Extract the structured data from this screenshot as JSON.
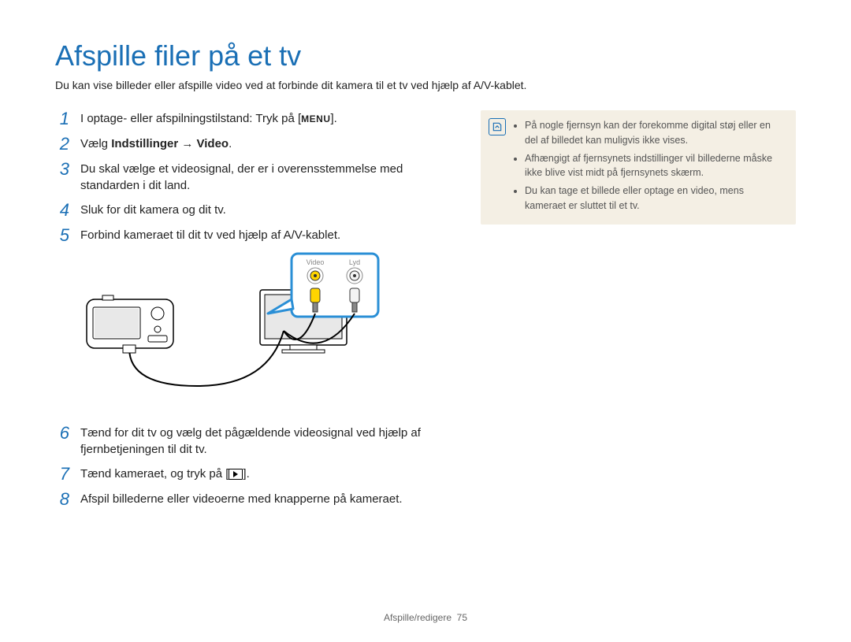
{
  "title": "Afspille filer på et tv",
  "intro": "Du kan vise billeder eller afspille video ved at forbinde dit kamera til et tv ved hjælp af A/V-kablet.",
  "steps": [
    {
      "num": "1",
      "pre": "I optage- eller afspilningstilstand: Tryk på [",
      "menu": "MENU",
      "post": "]."
    },
    {
      "num": "2",
      "pre": "Vælg ",
      "bold": "Indstillinger → Video",
      "post": "."
    },
    {
      "num": "3",
      "text": "Du skal vælge et videosignal, der er i overensstemmelse med standarden i dit land."
    },
    {
      "num": "4",
      "text": "Sluk for dit kamera og dit tv."
    },
    {
      "num": "5",
      "text": "Forbind kameraet til dit tv ved hjælp af A/V-kablet."
    },
    {
      "num": "6",
      "text": "Tænd for dit tv og vælg det pågældende videosignal ved hjælp af fjernbetjeningen til dit tv."
    },
    {
      "num": "7",
      "pre": "Tænd kameraet, og tryk på [",
      "play": true,
      "post": "]."
    },
    {
      "num": "8",
      "text": "Afspil billederne eller videoerne med knapperne på kameraet."
    }
  ],
  "diagram": {
    "label_video": "Video",
    "label_audio": "Lyd"
  },
  "notes": [
    "På nogle fjernsyn kan der forekomme digital støj eller en del af billedet kan muligvis ikke vises.",
    "Afhængigt af fjernsynets indstillinger vil billederne måske ikke blive vist midt på fjernsynets skærm.",
    "Du kan tage et billede eller optage en video, mens kameraet er sluttet til et tv."
  ],
  "footer": {
    "section": "Afspille/redigere",
    "page": "75"
  }
}
